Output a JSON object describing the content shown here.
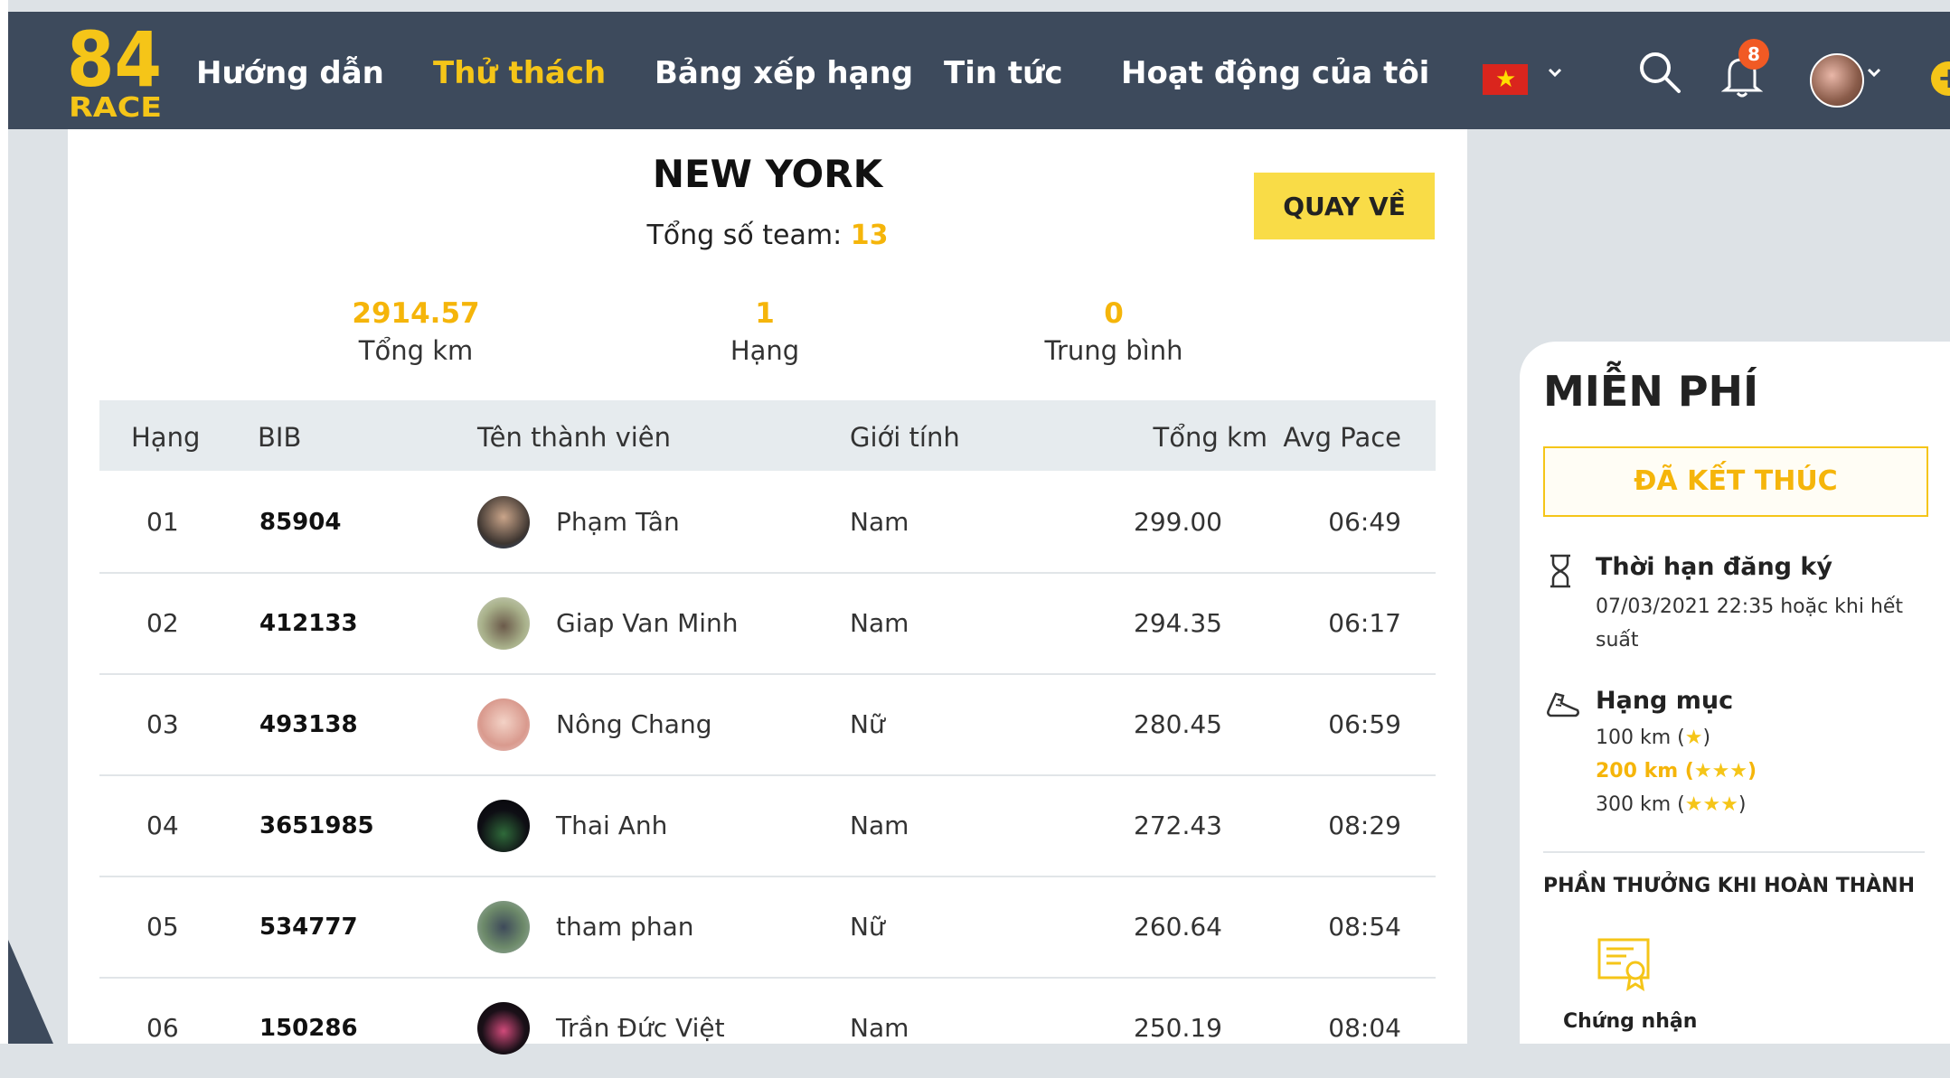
{
  "nav": {
    "logo_top": "84",
    "logo_bottom": "RACE",
    "items": [
      "Hướng dẫn",
      "Thử thách",
      "Bảng xếp hạng",
      "Tin tức",
      "Hoạt động của tôi"
    ],
    "active_index": 1,
    "notification_count": "8",
    "language_flag": "vietnam-flag-icon"
  },
  "page": {
    "title": "NEW YORK",
    "team_count_label": "Tổng số team:",
    "team_count_value": "13",
    "back_button": "QUAY VỀ"
  },
  "stats": [
    {
      "value": "2914.57",
      "label": "Tổng km"
    },
    {
      "value": "1",
      "label": "Hạng"
    },
    {
      "value": "0",
      "label": "Trung bình"
    }
  ],
  "table": {
    "headers": [
      "Hạng",
      "BIB",
      "Tên thành viên",
      "Giới tính",
      "Tổng km",
      "Avg Pace"
    ],
    "rows": [
      {
        "rank": "01",
        "bib": "85904",
        "name": "Phạm Tân",
        "gender": "Nam",
        "km": "299.00",
        "pace": "06:49"
      },
      {
        "rank": "02",
        "bib": "412133",
        "name": "Giap Van Minh",
        "gender": "Nam",
        "km": "294.35",
        "pace": "06:17"
      },
      {
        "rank": "03",
        "bib": "493138",
        "name": "Nông Chang",
        "gender": "Nữ",
        "km": "280.45",
        "pace": "06:59"
      },
      {
        "rank": "04",
        "bib": "3651985",
        "name": "Thai Anh",
        "gender": "Nam",
        "km": "272.43",
        "pace": "08:29"
      },
      {
        "rank": "05",
        "bib": "534777",
        "name": "tham phan",
        "gender": "Nữ",
        "km": "260.64",
        "pace": "08:54"
      },
      {
        "rank": "06",
        "bib": "150286",
        "name": "Trần Đức Việt",
        "gender": "Nam",
        "km": "250.19",
        "pace": "08:04"
      }
    ]
  },
  "sidebar": {
    "title": "MIỄN PHÍ",
    "status": "ĐÃ KẾT THÚC",
    "deadline_label": "Thời hạn đăng ký",
    "deadline_line1": "07/03/2021 22:35 hoặc khi hết",
    "deadline_line2": "suất",
    "category_label": "Hạng mục",
    "categories": [
      {
        "text": "100 km (",
        "stars": "★",
        "close": ")"
      },
      {
        "text": "200 km (",
        "stars": "★★★",
        "close": ")"
      },
      {
        "text": "300 km (",
        "stars": "★★★",
        "close": ")"
      }
    ],
    "highlighted_category": 1,
    "reward_title": "PHẦN THƯỞNG KHI HOÀN THÀNH",
    "certificate_label": "Chứng nhận"
  },
  "colors": {
    "navbar": "#3d4a5c",
    "accent": "#f5c518",
    "accent_text": "#f5b50a",
    "background": "#dde2e6"
  }
}
